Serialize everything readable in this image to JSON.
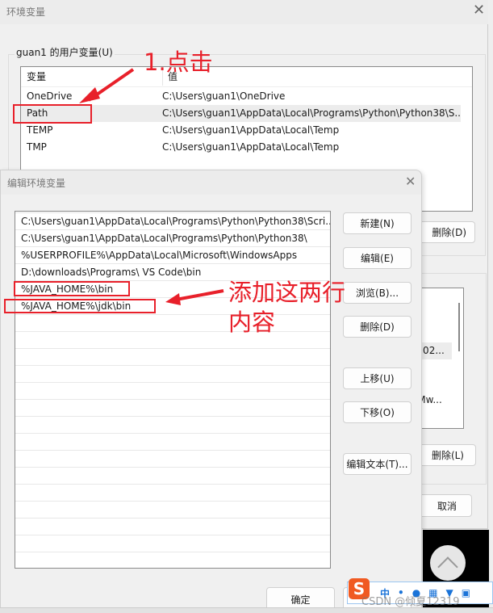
{
  "env_window": {
    "title": "环境变量",
    "user_group_label": "guan1 的用户变量(U)",
    "columns": [
      "变量",
      "值"
    ],
    "rows": [
      {
        "name": "OneDrive",
        "value": "C:\\Users\\guan1\\OneDrive"
      },
      {
        "name": "Path",
        "value": "C:\\Users\\guan1\\AppData\\Local\\Programs\\Python\\Python38\\S..."
      },
      {
        "name": "TEMP",
        "value": "C:\\Users\\guan1\\AppData\\Local\\Temp"
      },
      {
        "name": "TMP",
        "value": "C:\\Users\\guan1\\AppData\\Local\\Temp"
      }
    ],
    "delete_user_button": "删除(D)",
    "system_rows_partial": [
      "n 202...",
      "\\VMw..."
    ],
    "delete_system_button": "删除(L)",
    "cancel_button": "取消"
  },
  "edit_dialog": {
    "title": "编辑环境变量",
    "entries": [
      "C:\\Users\\guan1\\AppData\\Local\\Programs\\Python\\Python38\\Scri...",
      "C:\\Users\\guan1\\AppData\\Local\\Programs\\Python\\Python38\\",
      "%USERPROFILE%\\AppData\\Local\\Microsoft\\WindowsApps",
      "D:\\downloads\\Programs\\ VS Code\\bin",
      "%JAVA_HOME%\\bin",
      "%JAVA_HOME%\\jdk\\bin"
    ],
    "buttons": {
      "new": "新建(N)",
      "edit": "编辑(E)",
      "browse": "浏览(B)...",
      "delete": "删除(D)",
      "move_up": "上移(U)",
      "move_down": "下移(O)",
      "edit_text": "编辑文本(T)..."
    },
    "ok_button": "确定"
  },
  "annotations": {
    "click": "1.点击",
    "add_line1": "添加这两行",
    "add_line2": "内容",
    "color": "#e8202a"
  },
  "ime_toolbar": {
    "mode": "中"
  },
  "watermark": "CSDN @倾夏12319"
}
